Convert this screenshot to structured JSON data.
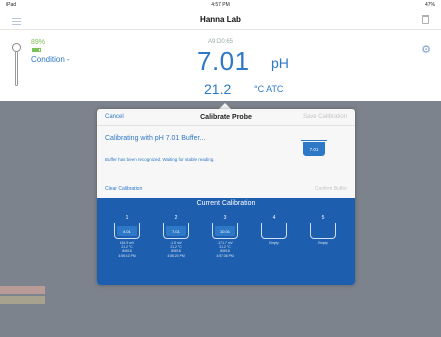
{
  "status_bar": {
    "device": "iPad",
    "time": "4:57 PM",
    "battery": "47%"
  },
  "nav": {
    "title": "Hanna Lab"
  },
  "reading": {
    "probe_battery": "89%",
    "probe_battery_level": 0.89,
    "condition": "Condition -",
    "probe_id": "A9:D0:65",
    "ph_value": "7.01",
    "ph_unit": "pH",
    "temp_value": "21.2",
    "temp_unit": "°C ATC"
  },
  "modal": {
    "cancel_label": "Cancel",
    "title": "Calibrate Probe",
    "save_label": "Save Calibration",
    "message": "Calibrating with pH 7.01 Buffer...",
    "status": "Buffer has been recognized.  Waiting for stable reading.",
    "current_buffer": "7.01",
    "clear_label": "Clear Calibration",
    "confirm_label": "Confirm Buffer",
    "calibration": {
      "title": "Current Calibration",
      "slots": [
        {
          "num": "1",
          "buffer": "4.01",
          "line1": "181.9 mV",
          "line2": "21.2 °C",
          "line3": "8/8/18",
          "line4": "4:55:10 PM"
        },
        {
          "num": "2",
          "buffer": "7.01",
          "line1": "-1.5 mV",
          "line2": "21.2 °C",
          "line3": "8/8/18",
          "line4": "4:56:20 PM"
        },
        {
          "num": "3",
          "buffer": "10.01",
          "line1": "-171.7 mV",
          "line2": "21.2 °C",
          "line3": "8/8/18",
          "line4": "4:57:38 PM"
        },
        {
          "num": "4",
          "buffer": "",
          "line1": "Empty",
          "line2": "",
          "line3": "",
          "line4": ""
        },
        {
          "num": "5",
          "buffer": "",
          "line1": "Empty",
          "line2": "",
          "line3": "",
          "line4": ""
        }
      ]
    }
  },
  "colors": {
    "accent": "#2e78c8",
    "calibration_panel": "#1d5eae",
    "battery": "#7cc25a"
  }
}
